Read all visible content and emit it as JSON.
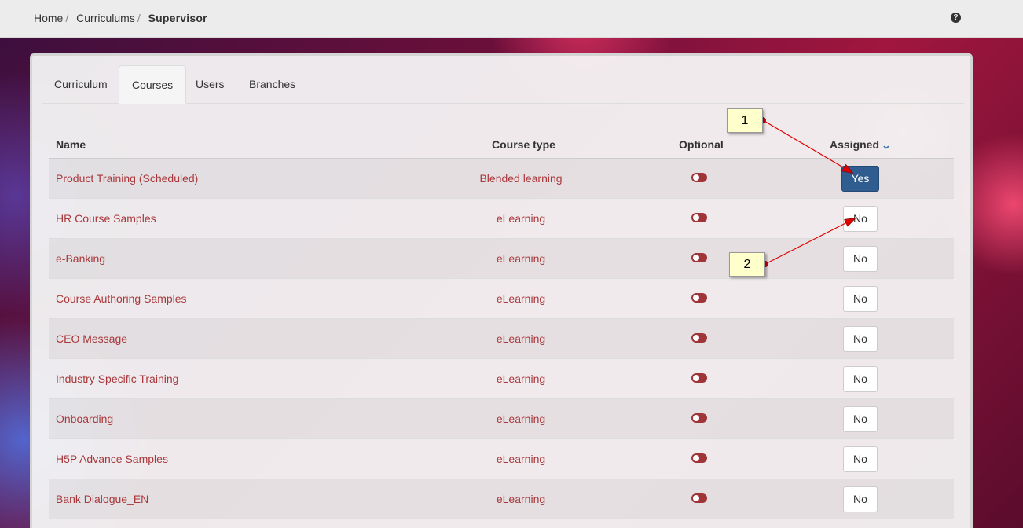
{
  "breadcrumb": {
    "items": [
      "Home",
      "Curriculums"
    ],
    "current": "Supervisor"
  },
  "help_icon": "question-circle-icon",
  "tabs": [
    {
      "label": "Curriculum",
      "active": false
    },
    {
      "label": "Courses",
      "active": true
    },
    {
      "label": "Users",
      "active": false
    },
    {
      "label": "Branches",
      "active": false
    }
  ],
  "table": {
    "headers": {
      "name": "Name",
      "course_type": "Course type",
      "optional": "Optional",
      "assigned": "Assigned"
    },
    "sort_icon": "chevron-down-icon",
    "rows": [
      {
        "name": "Product Training (Scheduled)",
        "type": "Blended learning",
        "assigned": "Yes"
      },
      {
        "name": "HR Course Samples",
        "type": "eLearning",
        "assigned": "No"
      },
      {
        "name": "e-Banking",
        "type": "eLearning",
        "assigned": "No"
      },
      {
        "name": "Course Authoring Samples",
        "type": "eLearning",
        "assigned": "No"
      },
      {
        "name": "CEO Message",
        "type": "eLearning",
        "assigned": "No"
      },
      {
        "name": "Industry Specific Training",
        "type": "eLearning",
        "assigned": "No"
      },
      {
        "name": "Onboarding",
        "type": "eLearning",
        "assigned": "No"
      },
      {
        "name": "H5P Advance Samples",
        "type": "eLearning",
        "assigned": "No"
      },
      {
        "name": "Bank Dialogue_EN",
        "type": "eLearning",
        "assigned": "No"
      }
    ]
  },
  "callouts": [
    "1",
    "2"
  ],
  "colors": {
    "link": "#a8383b",
    "toggle": "#a03539",
    "primary_button": "#2f5d8f",
    "callout_bg": "#ffffcc",
    "arrow": "#e00000"
  }
}
